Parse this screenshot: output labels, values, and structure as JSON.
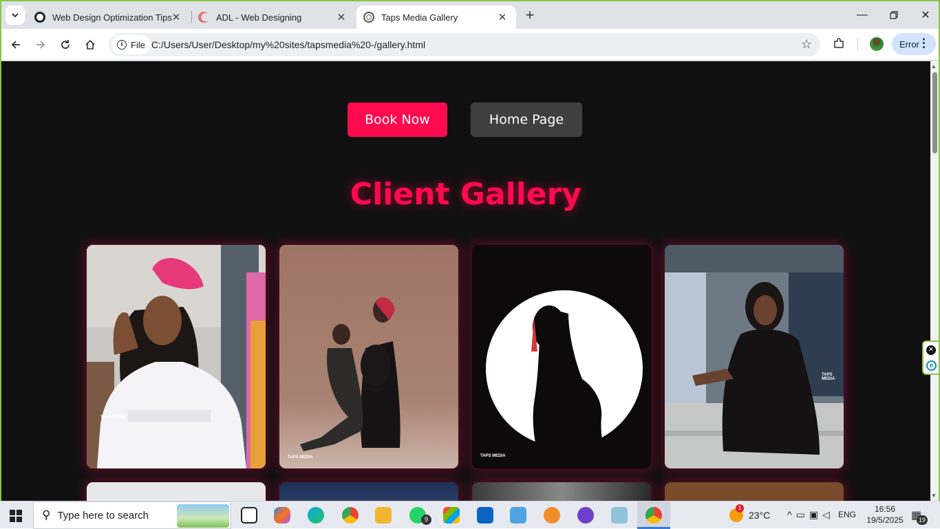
{
  "browser": {
    "tabs": [
      {
        "title": "Web Design Optimization Tips",
        "icon": "chatgpt-icon"
      },
      {
        "title": "ADL - Web Designing",
        "icon": "adl-icon"
      },
      {
        "title": "Taps Media Gallery",
        "icon": "globe-icon",
        "active": true
      }
    ],
    "address": {
      "chip_label": "File",
      "url": "C:/Users/User/Desktop/my%20sites/tapsmedia%20-/gallery.html"
    },
    "profile_error_label": "Error"
  },
  "page": {
    "buttons": {
      "book_now": "Book Now",
      "home_page": "Home Page"
    },
    "gallery_title": "Client Gallery",
    "watermark": "TAPS MEDIA",
    "accent_color": "#ff0a4f",
    "photos": [
      {
        "name": "woman-white-dress-pink-fascinator"
      },
      {
        "name": "couple-maternity-kiss"
      },
      {
        "name": "maternity-silhouette-circle-light"
      },
      {
        "name": "woman-black-dress-seated-stairs"
      }
    ]
  },
  "taskbar": {
    "search_placeholder": "Type here to search",
    "whatsapp_badge": "9",
    "weather": "23°C",
    "weather_badge": "1",
    "language": "ENG",
    "time": "16:56",
    "date": "19/5/2025",
    "notification_count": "19"
  }
}
